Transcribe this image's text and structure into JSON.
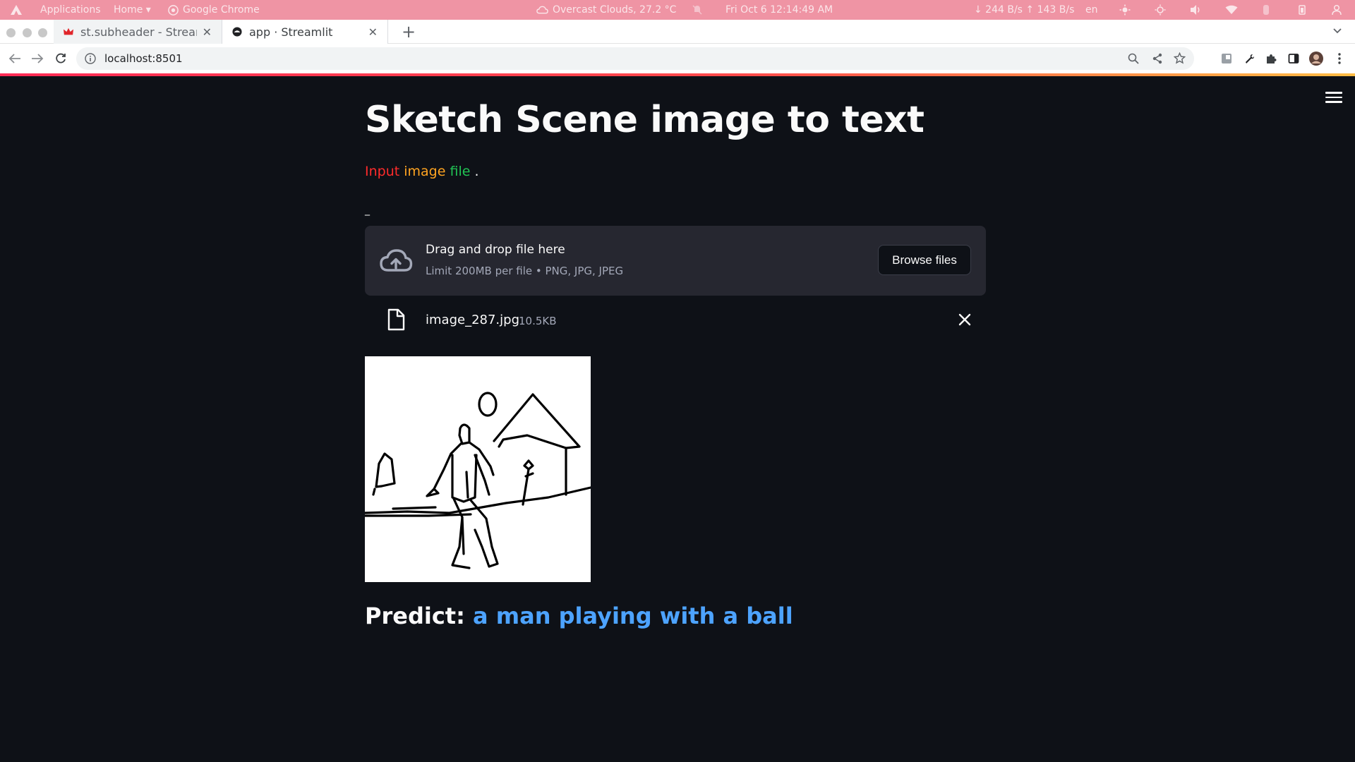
{
  "os_panel": {
    "applications": "Applications",
    "home": "Home ▾",
    "app_name": "Google Chrome",
    "weather": "Overcast Clouds, 27.2 °C",
    "datetime": "Fri Oct 6  12:14:49 AM",
    "network": "↓ 244 B/s ↑ 143 B/s",
    "language": "en"
  },
  "tabs": [
    {
      "title": "st.subheader - Stream",
      "active": false
    },
    {
      "title": "app · Streamlit",
      "active": true
    }
  ],
  "toolbar": {
    "url": "localhost:8501"
  },
  "main": {
    "title": "Sketch Scene image to text",
    "subtitle": {
      "word1": "Input",
      "word2": "image",
      "word3": "file",
      "punct": ".",
      "colors": {
        "word1": "#ff2b2b",
        "word2": "#ffa421",
        "word3": "#21c354",
        "punct": "#fafafa"
      }
    },
    "uploader": {
      "label": "_",
      "drop_title": "Drag and drop file here",
      "limits": "Limit 200MB per file • PNG, JPG, JPEG",
      "browse_label": "Browse files"
    },
    "file": {
      "name": "image_287.jpg",
      "size": "10.5KB"
    },
    "predict": {
      "label": "Predict:",
      "value": "a man playing with a ball"
    }
  },
  "colors": {
    "background": "#0e1117",
    "dropzone": "#262730",
    "text": "#fafafa",
    "muted": "#a3a8b8",
    "predict_value": "#4da3ff",
    "os_panel": "#ef94a4"
  }
}
